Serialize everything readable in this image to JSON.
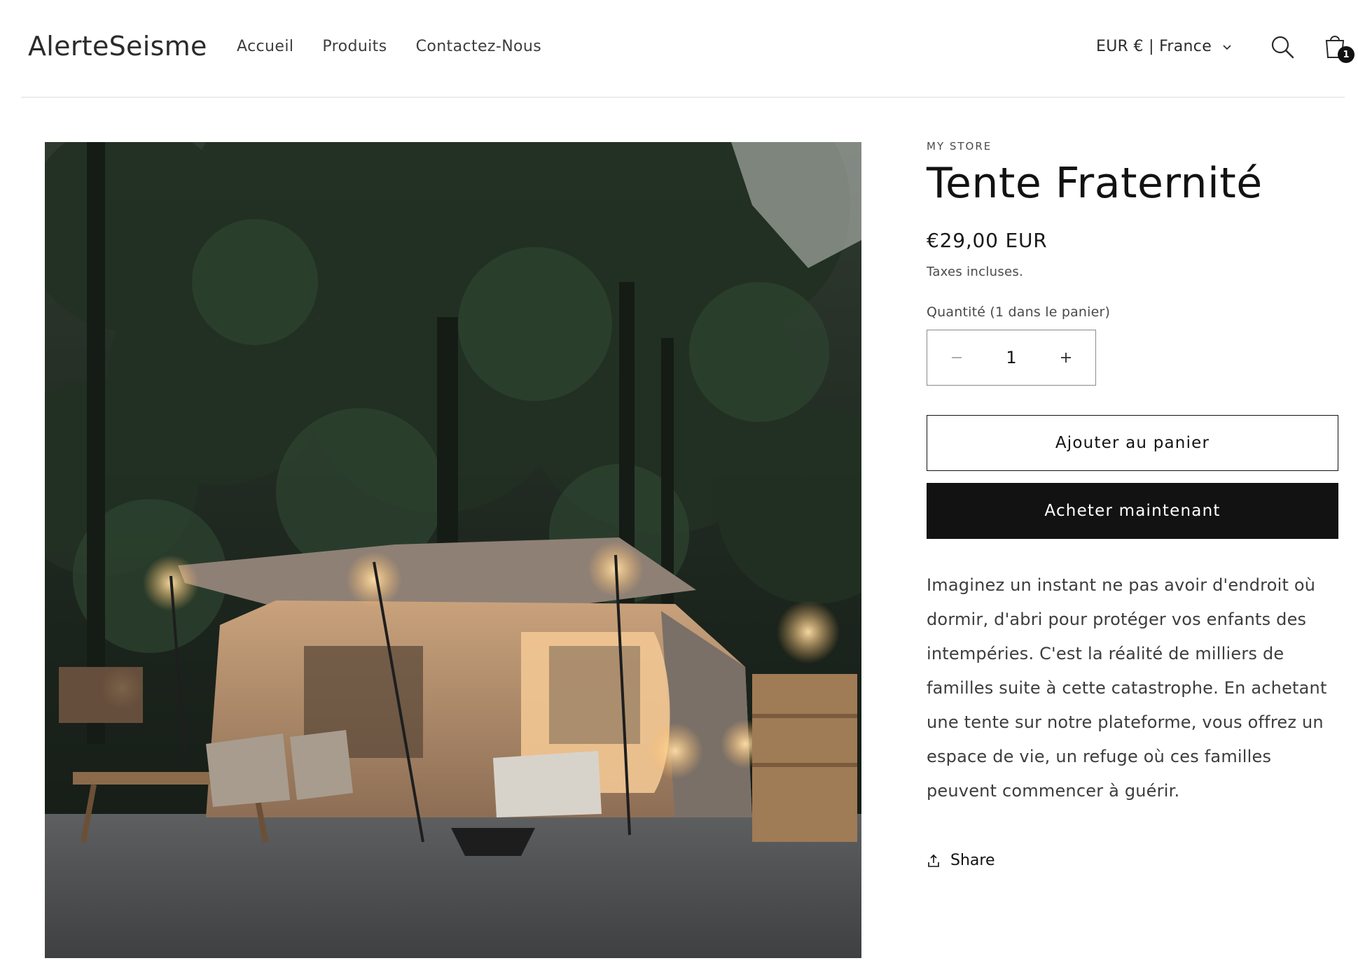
{
  "header": {
    "logo": "AlerteSeisme",
    "nav": [
      "Accueil",
      "Produits",
      "Contactez-Nous"
    ],
    "currency": "EUR € | France",
    "cart_count": "1"
  },
  "product": {
    "vendor": "MY STORE",
    "title": "Tente Fraternité",
    "price": "€29,00 EUR",
    "tax_note": "Taxes incluses.",
    "quantity_label": "Quantité (1 dans le panier)",
    "quantity_value": "1",
    "add_to_cart": "Ajouter au panier",
    "buy_now": "Acheter maintenant",
    "description": "Imaginez un instant ne pas avoir d'endroit où dormir, d'abri pour protéger vos enfants des intempéries. C'est la réalité de milliers de familles suite à cette catastrophe. En achetant une tente sur notre plateforme, vous offrez un espace de vie, un refuge où ces familles peuvent commencer à guérir.",
    "share": "Share"
  },
  "icons": {
    "search": "search-icon",
    "cart": "cart-icon",
    "chevron": "chevron-down-icon",
    "share": "share-icon",
    "minus": "minus-icon",
    "plus": "plus-icon"
  }
}
